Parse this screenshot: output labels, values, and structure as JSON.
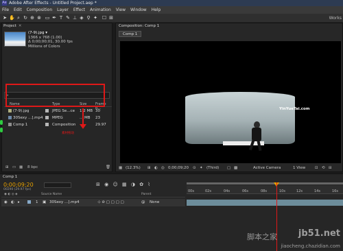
{
  "window": {
    "title": "Adobe After Effects - Untitled Project.aep *",
    "logo": "Ae"
  },
  "menu": [
    "File",
    "Edit",
    "Composition",
    "Layer",
    "Effect",
    "Animation",
    "View",
    "Window",
    "Help"
  ],
  "toolbar": {
    "workspace": "Works"
  },
  "project": {
    "tab": "Project",
    "selected": {
      "name": "(7-9).jpg ▾",
      "dims": "1366 x 768 (1.00)",
      "duration": "Δ 0;00;00;01, 30.00 fps",
      "colors": "Millions of Colors"
    },
    "columns": {
      "name": "Name",
      "type": "Type",
      "size": "Size",
      "frame_rate": "Frame R..."
    },
    "items": [
      {
        "name": "(7-9).jpg",
        "type": "JPEG Se...ce",
        "size": "1.2 MB",
        "rate": "30"
      },
      {
        "name": "30Sexy ...].mp4",
        "type": "MPEG",
        "size": "... MB",
        "rate": "23"
      },
      {
        "name": "Comp 1",
        "type": "Composition",
        "size": "",
        "rate": "29.97"
      }
    ],
    "callout": "素材拖动",
    "footer_bpc": "8 bpc"
  },
  "composition": {
    "tab": "Composition: Comp 1",
    "subtab": "Comp 1",
    "watermark": "YinYueTai.com",
    "zoom": "(12.3%)",
    "timecode": "0;00;09;20",
    "resolution": "(Third)",
    "camera": "Active Camera",
    "view": "1 View"
  },
  "timeline": {
    "tab": "Comp 1",
    "timecode": "0;00;09;20",
    "fps": "00290 (29.97 fps)",
    "columns": {
      "source": "Source Name",
      "parent": "Parent"
    },
    "layer": {
      "index": "1",
      "name": "30Sexy ...].mp4",
      "parent": "None"
    },
    "ruler": [
      "00s",
      "02s",
      "04s",
      "06s",
      "08s",
      "10s",
      "12s",
      "14s",
      "16s"
    ]
  },
  "site_watermark": {
    "big": "jb51.net",
    "small": "jiaocheng.chazidian.com",
    "cn": "脚本之家"
  }
}
